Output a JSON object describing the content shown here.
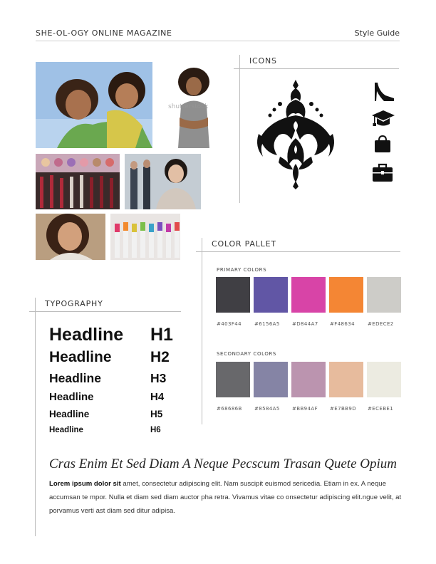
{
  "header": {
    "magazine_title": "SHE-OL-OGY ONLINE MAGAZINE",
    "guide_label": "Style Guide"
  },
  "photos": {
    "watermark": "shutterstock",
    "items": [
      {
        "name": "photo-mother-daughter"
      },
      {
        "name": "photo-woman-curly-hair"
      },
      {
        "name": "photo-makeup-brushes"
      },
      {
        "name": "photo-business-woman"
      },
      {
        "name": "photo-smiling-woman"
      },
      {
        "name": "photo-colorful-lipsticks"
      }
    ]
  },
  "icons_section": {
    "title": "ICONS",
    "items": [
      {
        "name": "damask-ornament-icon"
      },
      {
        "name": "high-heel-shoe-icon"
      },
      {
        "name": "graduation-cap-icon"
      },
      {
        "name": "shopping-bag-icon"
      },
      {
        "name": "briefcase-icon"
      }
    ]
  },
  "color_section": {
    "title": "COLOR PALLET",
    "primary_label": "PRIMARY COLORS",
    "primary": [
      {
        "hex": "#403F44",
        "label": "#403F44"
      },
      {
        "hex": "#6156A5",
        "label": "#6156A5"
      },
      {
        "hex": "#D844A7",
        "label": "#D844A7"
      },
      {
        "hex": "#F48634",
        "label": "#F48634"
      },
      {
        "hex": "#CDCCC8",
        "label": "#EDECE2"
      }
    ],
    "secondary_label": "SECONDARY COLORS",
    "secondary": [
      {
        "hex": "#68686B",
        "label": "#68686B"
      },
      {
        "hex": "#8584A5",
        "label": "#8584A5"
      },
      {
        "hex": "#BB94AF",
        "label": "#BB94AF"
      },
      {
        "hex": "#E7BB9D",
        "label": "#E7BB9D"
      },
      {
        "hex": "#ECEBE1",
        "label": "#ECEBE1"
      }
    ]
  },
  "typography": {
    "title": "TYPOGRAPHY",
    "rows": [
      {
        "text": "Headline",
        "level": "H1"
      },
      {
        "text": "Headline",
        "level": "H2"
      },
      {
        "text": "Headline",
        "level": "H3"
      },
      {
        "text": "Headline",
        "level": "H4"
      },
      {
        "text": "Headline",
        "level": "H5"
      },
      {
        "text": "Headline",
        "level": "H6"
      }
    ]
  },
  "sample": {
    "quote": "Cras Enim Et Sed Diam A Neque Pecscum Trasan Quete  Opium",
    "lead": "Lorem ipsum dolor sit",
    "body": " amet, consectetur adipiscing elit. Nam suscipit euismod sericedia. Etiam in ex. A neque accumsan te mpor. Nulla et diam sed diam auctor pha retra. Vivamus vitae co onsectetur adipiscing elit.ngue velit, at porvamus verti ast diam sed ditur adipisa."
  }
}
